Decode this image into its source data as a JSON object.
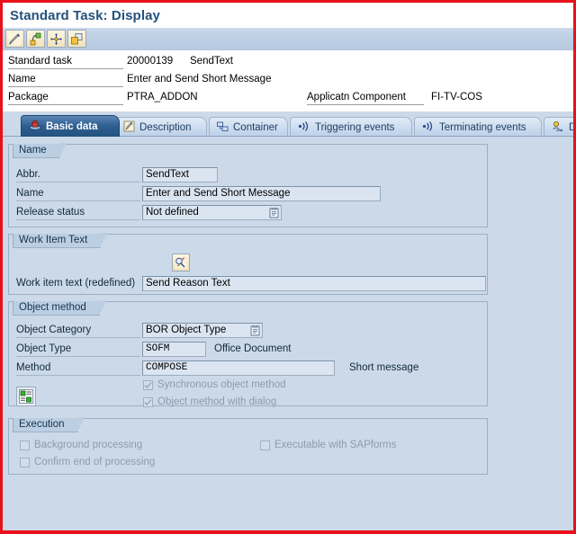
{
  "window": {
    "title": "Standard Task: Display"
  },
  "toolbar": {
    "buttons": [
      {
        "name": "display-change-button",
        "icon": "pencil-display-change-icon",
        "tooltip": "Display <-> Change"
      },
      {
        "name": "workflow-builder-button",
        "icon": "workflow-node-icon",
        "tooltip": "Workflow Builder"
      },
      {
        "name": "where-used-button",
        "icon": "navigation-arrows-icon",
        "tooltip": "Where-Used List"
      },
      {
        "name": "copy-task-button",
        "icon": "copy-object-icon",
        "tooltip": "Copy"
      }
    ]
  },
  "header": {
    "task_label": "Standard task",
    "task_id": "20000139",
    "task_abbr": "SendText",
    "name_label": "Name",
    "name_value": "Enter and Send Short Message",
    "package_label": "Package",
    "package_value": "PTRA_ADDON",
    "appl_component_label": "Applicatn Component",
    "appl_component_value": "FI-TV-COS"
  },
  "tabs": [
    {
      "label": "Basic data",
      "icon": "basic-data-icon",
      "active": true
    },
    {
      "label": "Description",
      "icon": "description-pencil-icon",
      "active": false
    },
    {
      "label": "Container",
      "icon": "container-icon",
      "active": false
    },
    {
      "label": "Triggering events",
      "icon": "events-signal-icon",
      "active": false
    },
    {
      "label": "Terminating events",
      "icon": "events-signal-icon",
      "active": false
    },
    {
      "label": "D",
      "icon": "default-rules-icon",
      "active": false
    }
  ],
  "name_group": {
    "title": "Name",
    "abbr_label": "Abbr.",
    "abbr_value": "SendText",
    "name_label": "Name",
    "name_value": "Enter and Send Short Message",
    "release_label": "Release status",
    "release_value": "Not defined"
  },
  "work_item_text_group": {
    "title": "Work Item Text",
    "edit_button_icon": "edit-text-icon",
    "label": "Work item text (redefined)",
    "value": "Send Reason Text"
  },
  "object_method_group": {
    "title": "Object method",
    "object_category_label": "Object Category",
    "object_category_value": "BOR Object Type",
    "object_type_label": "Object Type",
    "object_type_value": "SOFM",
    "object_type_desc": "Office Document",
    "method_label": "Method",
    "method_value": "COMPOSE",
    "method_desc": "Short message",
    "sync_checkbox_label": "Synchronous object method",
    "sync_checkbox_checked": true,
    "dialog_checkbox_label": "Object method with dialog",
    "dialog_checkbox_checked": true,
    "detail_button_icon": "object-method-detail-icon"
  },
  "execution_group": {
    "title": "Execution",
    "background_label": "Background processing",
    "background_checked": false,
    "confirm_label": "Confirm end of processing",
    "confirm_checked": false,
    "sapforms_label": "Executable with SAPforms",
    "sapforms_checked": false
  },
  "colors": {
    "page_background": "#ccd9e8",
    "title_text": "#23527c",
    "active_tab": "#2f5e92",
    "field_background": "#dbe5f1",
    "group_border": "#9bb0c6",
    "disabled_text": "#8c9cac",
    "annotation_border": "#e8111b"
  }
}
